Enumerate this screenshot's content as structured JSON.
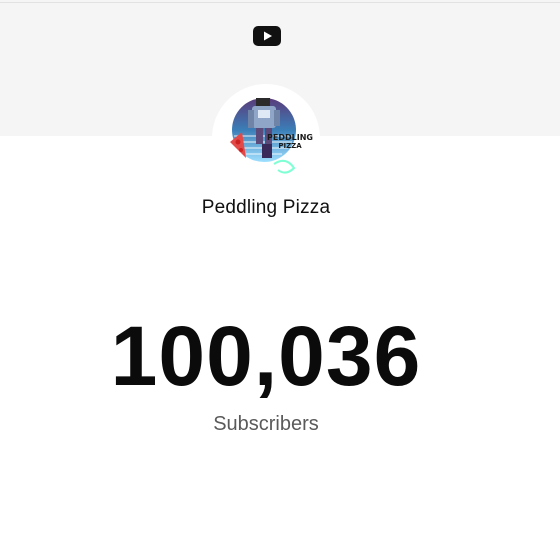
{
  "header": {
    "logo_icon": "youtube-play-icon",
    "logo_color": "#111111"
  },
  "channel": {
    "name": "Peddling Pizza",
    "avatar_text_line1": "PEDDLING",
    "avatar_text_line2": "PIZZA"
  },
  "stats": {
    "subscriber_count": "100,036",
    "subscriber_label": "Subscribers"
  },
  "colors": {
    "banner": "#f5f5f5",
    "count_text": "#0b0b0b",
    "label_text": "#5a5a5a"
  }
}
